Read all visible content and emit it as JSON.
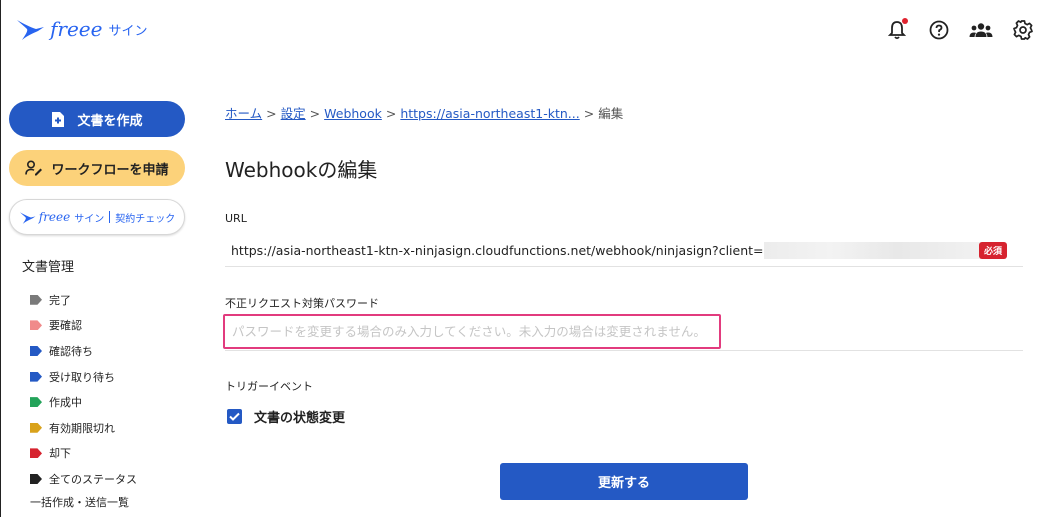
{
  "app": {
    "logo_text": "freee",
    "logo_sub": "サイン"
  },
  "header": {
    "icons": [
      "bell-icon",
      "help-icon",
      "team-icon",
      "gear-icon"
    ],
    "has_notification": true
  },
  "sidebar": {
    "create_label": "文書を作成",
    "workflow_label": "ワークフローを申請",
    "check": {
      "logo_text": "freee",
      "logo_sub": "サイン",
      "label": "契約チェック"
    },
    "section_title": "文書管理",
    "statuses": [
      {
        "label": "完了",
        "color": "#7a7a7a"
      },
      {
        "label": "要確認",
        "color": "#f08a8a"
      },
      {
        "label": "確認待ち",
        "color": "#2459c4"
      },
      {
        "label": "受け取り待ち",
        "color": "#2459c4"
      },
      {
        "label": "作成中",
        "color": "#23a35a"
      },
      {
        "label": "有効期限切れ",
        "color": "#d9a21b"
      },
      {
        "label": "却下",
        "color": "#d6232f"
      },
      {
        "label": "全てのステータス",
        "color": "#222222"
      }
    ],
    "bulk_label": "一括作成・送信一覧"
  },
  "breadcrumb": {
    "home": "ホーム",
    "settings": "設定",
    "webhook": "Webhook",
    "url": "https://asia-northeast1-ktn...",
    "current": "編集",
    "sep": ">"
  },
  "page_title": "Webhookの編集",
  "form": {
    "url_label": "URL",
    "url_value": "https://asia-northeast1-ktn-x-ninjasign.cloudfunctions.net/webhook/ninjasign?client=",
    "required_badge": "必須",
    "password_label": "不正リクエスト対策パスワード",
    "password_placeholder": "パスワードを変更する場合のみ入力してください。未入力の場合は変更されません。",
    "password_value": "",
    "trigger_label": "トリガーイベント",
    "trigger_option": "文書の状態変更",
    "trigger_checked": true,
    "submit_label": "更新する"
  }
}
